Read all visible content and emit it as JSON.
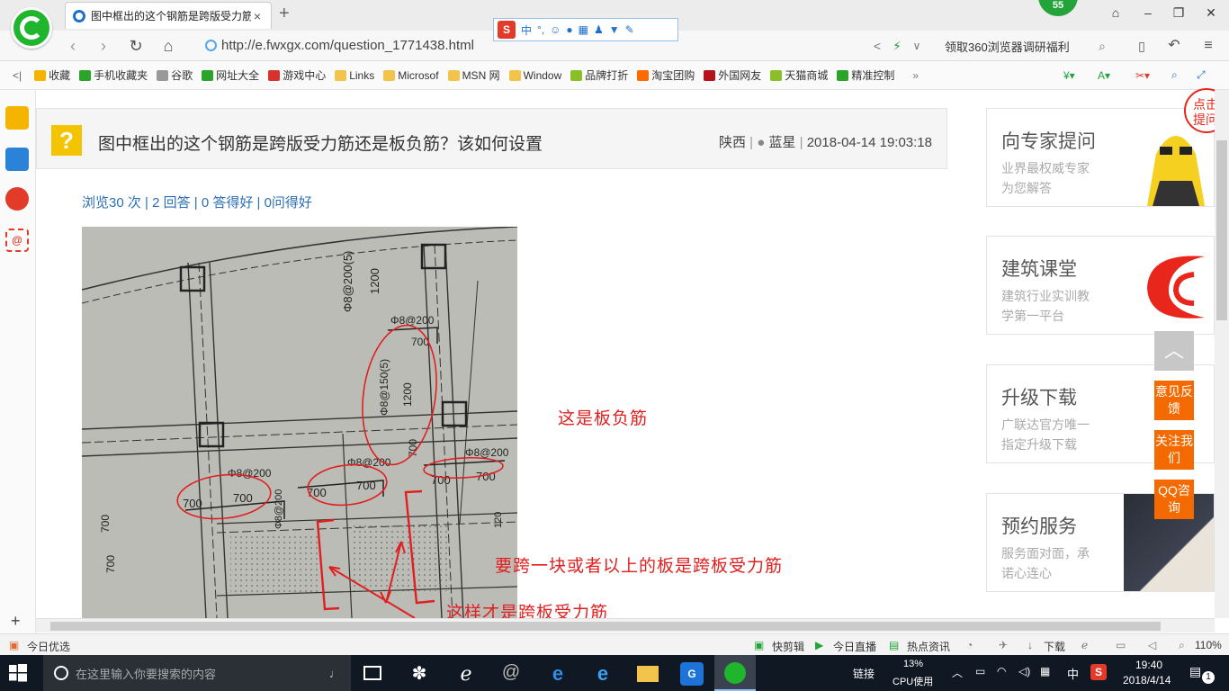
{
  "browser": {
    "tab_title": "图中框出的这个钢筋是跨版受力筋",
    "badge_count": "55",
    "url": "http://e.fwxgx.com/question_1771438.html",
    "promo_text": "领取360浏览器调研福利",
    "ime_label": "中"
  },
  "bookmarks": [
    {
      "label": "收藏",
      "icon": "star-icon",
      "color": "#f5b400"
    },
    {
      "label": "手机收藏夹",
      "icon": "phone-icon",
      "color": "#2aa52a"
    },
    {
      "label": "谷歌",
      "icon": "page-icon",
      "color": "#999999"
    },
    {
      "label": "网址大全",
      "icon": "globe-icon",
      "color": "#2aa52a"
    },
    {
      "label": "游戏中心",
      "icon": "game-icon",
      "color": "#d9322b"
    },
    {
      "label": "Links",
      "icon": "folder-icon",
      "color": "#f2c44c"
    },
    {
      "label": "Microsof",
      "icon": "folder-icon",
      "color": "#f2c44c"
    },
    {
      "label": "MSN 网",
      "icon": "folder-icon",
      "color": "#f2c44c"
    },
    {
      "label": "Window",
      "icon": "folder-icon",
      "color": "#f2c44c"
    },
    {
      "label": "品牌打折",
      "icon": "leaf-icon",
      "color": "#8bbf2a"
    },
    {
      "label": "淘宝团购",
      "icon": "taobao-icon",
      "color": "#ff6a00"
    },
    {
      "label": "外国网友",
      "icon": "flag-icon",
      "color": "#b5121b"
    },
    {
      "label": "天猫商城",
      "icon": "leaf-icon",
      "color": "#8bbf2a"
    },
    {
      "label": "精准控制",
      "icon": "wechat-icon",
      "color": "#2aa52a"
    }
  ],
  "question": {
    "title": "图中框出的这个钢筋是跨版受力筋还是板负筋？该如何设置",
    "region": "陕西",
    "author": "蓝星",
    "datetime": "2018-04-14 19:03:18",
    "stats": "浏览30 次 | 2 回答 | 0 答得好 | 0问得好"
  },
  "photo": {
    "labels": [
      "Φ8@200(5)",
      "1200",
      "Φ8@200",
      "700",
      "Φ8@150(5)",
      "1200",
      "700",
      "Φ8@200",
      "Φ8@200",
      "700",
      "700",
      "Φ8@200",
      "700",
      "700",
      "700",
      "700",
      "Φ8@200",
      "700",
      "700",
      "120"
    ]
  },
  "annotations": {
    "neg_bar": "这是板负筋",
    "span_rule": "要跨一块或者以上的板是跨板受力筋",
    "this_is": "这样才是跨板受力筋"
  },
  "sidebar_cards": [
    {
      "title": "向专家提问",
      "line1": "业界最权威专家",
      "line2": "为您解答"
    },
    {
      "title": "建筑课堂",
      "line1": "建筑行业实训教",
      "line2": "学第一平台"
    },
    {
      "title": "升级下载",
      "line1": "广联达官方唯一",
      "line2": "指定升级下载"
    },
    {
      "title": "预约服务",
      "line1": "服务面对面，承",
      "line2": "诺心连心"
    }
  ],
  "float_buttons": {
    "feedback": "意见反馈",
    "follow": "关注我们",
    "qq": "QQ咨询",
    "corner_tag": "点击提问"
  },
  "statusbar": {
    "today": "今日优选",
    "kuaijian": "快剪辑",
    "live": "今日直播",
    "news": "热点资讯",
    "download": "下载",
    "zoom": "110%"
  },
  "taskbar": {
    "search_placeholder": "在这里输入你要搜索的内容",
    "link_label": "链接",
    "cpu_percent": "13%",
    "cpu_label": "CPU使用",
    "ime": "中",
    "time": "19:40",
    "date": "2018/4/14",
    "notif_count": "1"
  }
}
